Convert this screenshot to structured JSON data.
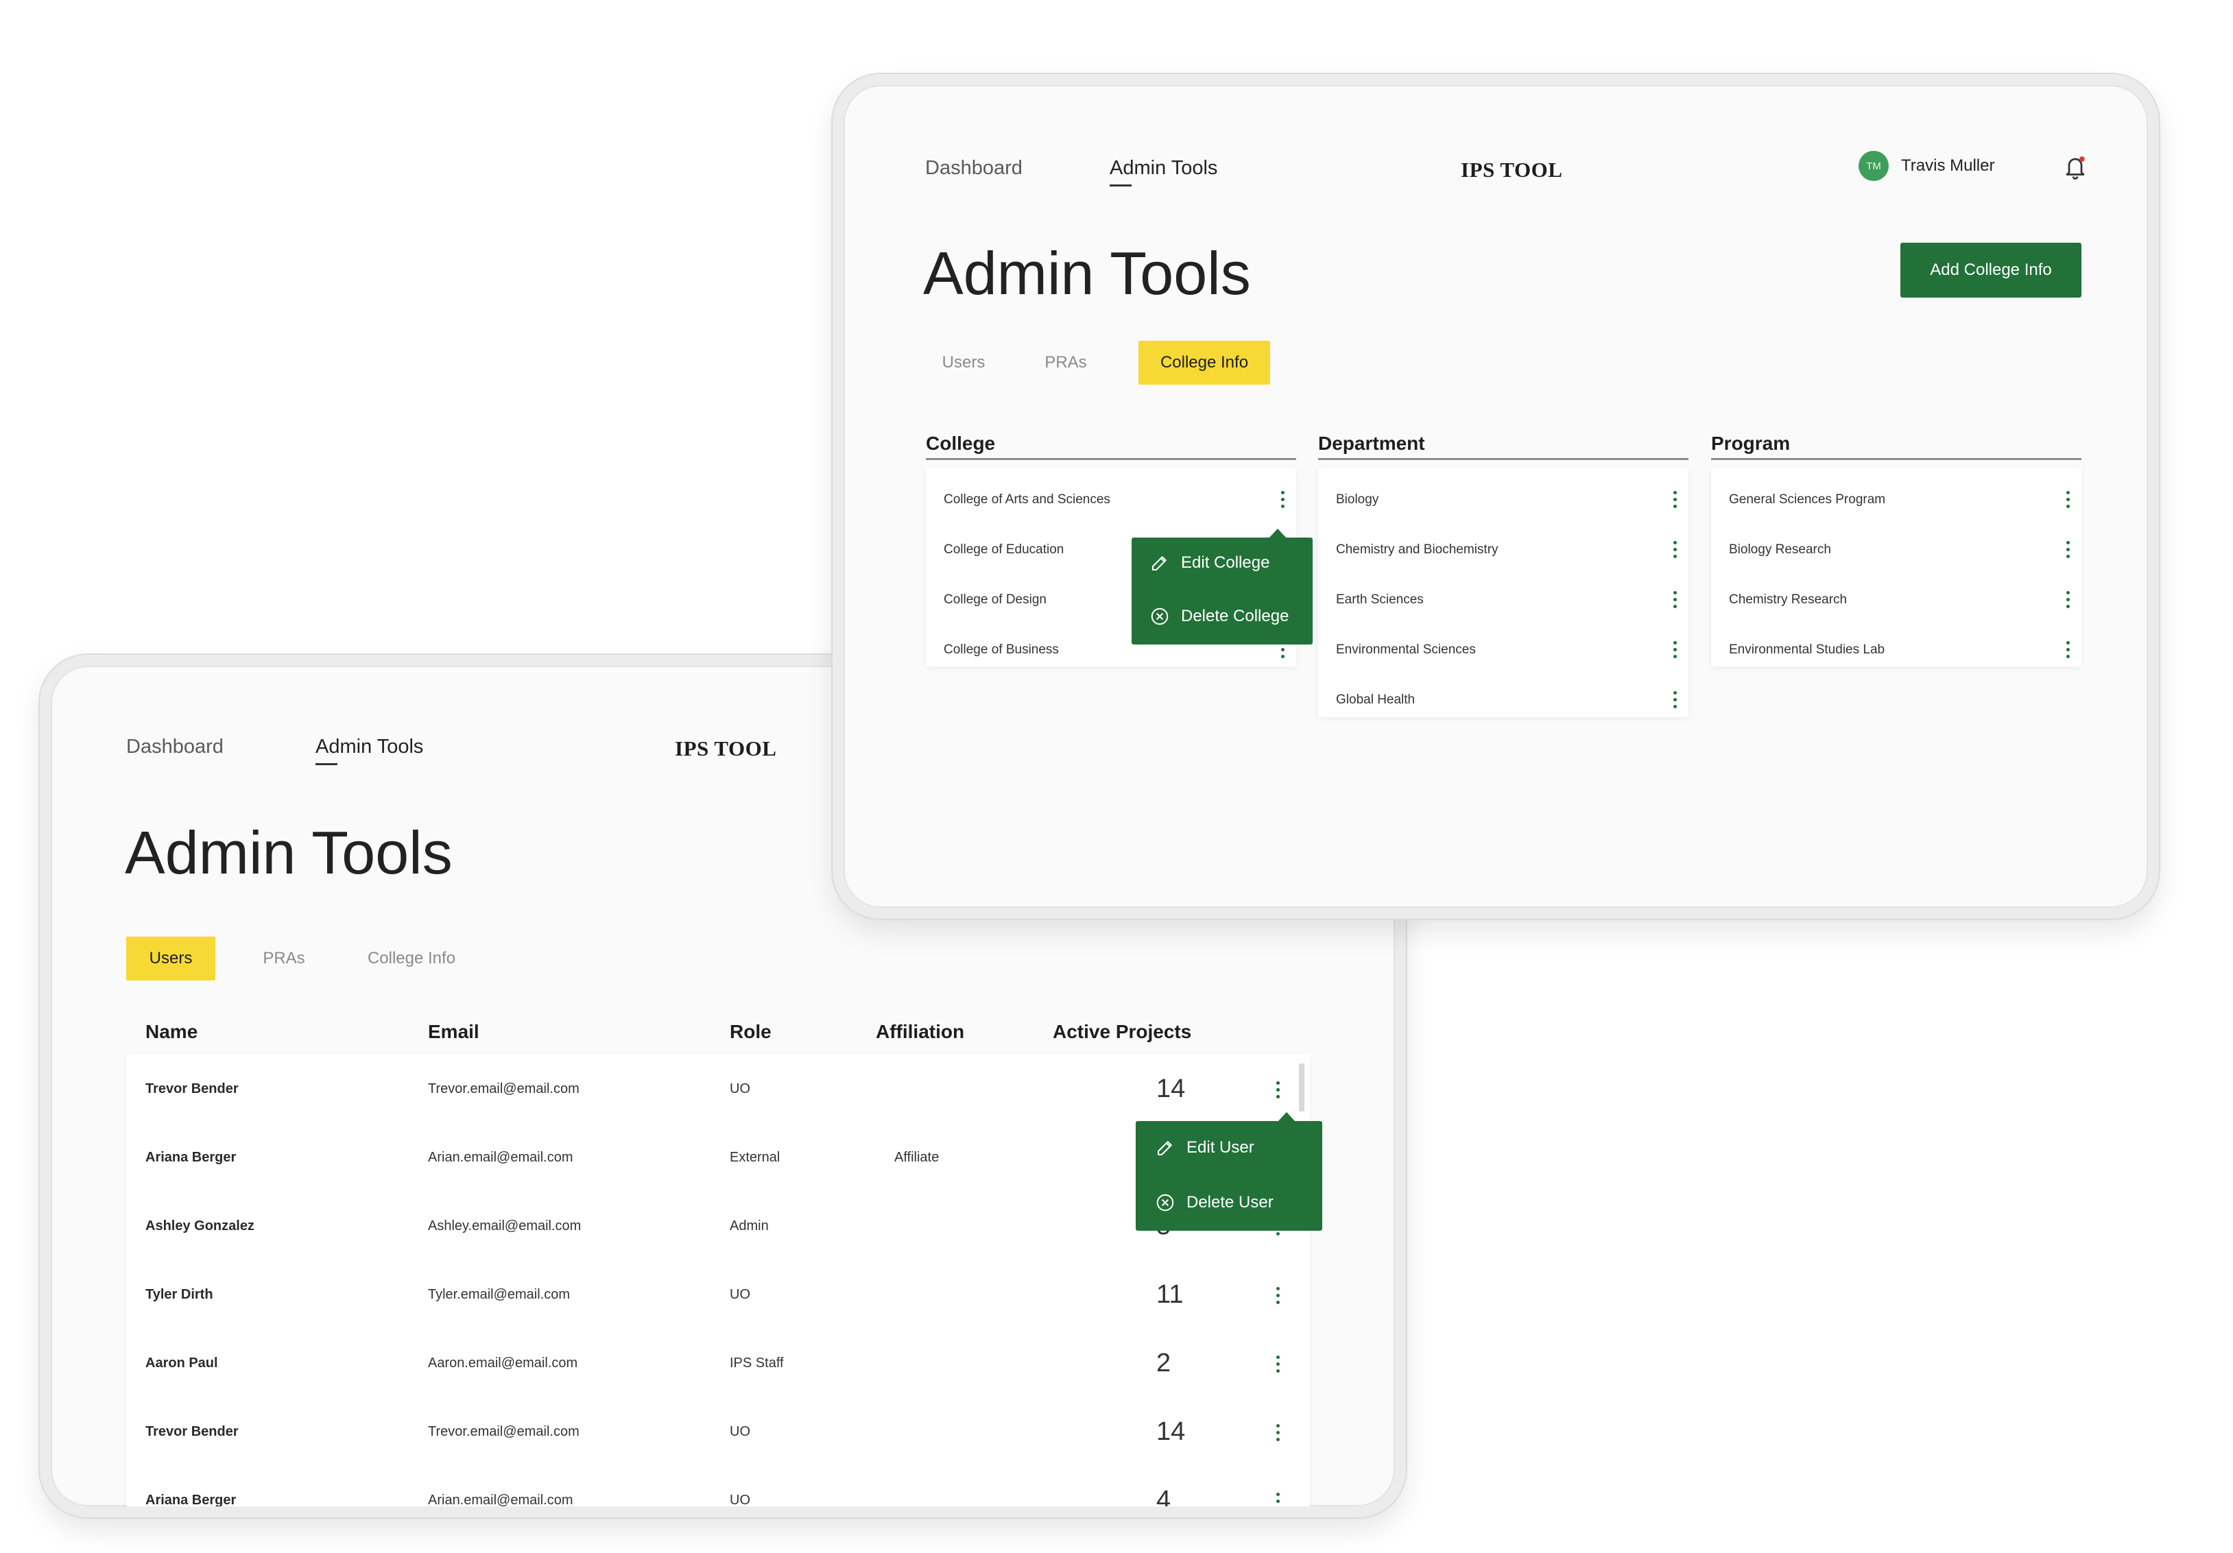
{
  "front": {
    "nav": {
      "dashboard": "Dashboard",
      "admin_tools": "Admin Tools",
      "brand": "IPS TOOL",
      "user_initials": "TM",
      "user_name": "Travis Muller"
    },
    "title": "Admin Tools",
    "primary_button": "Add College Info",
    "tabs": [
      "Users",
      "PRAs",
      "College Info"
    ],
    "active_tab": "College Info",
    "columns": {
      "college": {
        "header": "College",
        "items": [
          "College of Arts and Sciences",
          "College of Education",
          "College of Design",
          "College of Business"
        ]
      },
      "department": {
        "header": "Department",
        "items": [
          "Biology",
          "Chemistry and Biochemistry",
          "Earth Sciences",
          "Environmental Sciences",
          "Global Health"
        ]
      },
      "program": {
        "header": "Program",
        "items": [
          "General Sciences Program",
          "Biology Research",
          "Chemistry Research",
          "Environmental Studies Lab"
        ]
      }
    },
    "menu": {
      "edit": "Edit College",
      "delete": "Delete College"
    }
  },
  "back": {
    "nav": {
      "dashboard": "Dashboard",
      "admin_tools": "Admin Tools",
      "brand": "IPS TOOL"
    },
    "title": "Admin Tools",
    "tabs": [
      "Users",
      "PRAs",
      "College Info"
    ],
    "active_tab": "Users",
    "table": {
      "headers": [
        "Name",
        "Email",
        "Role",
        "Affiliation",
        "Active Projects"
      ],
      "rows": [
        {
          "name": "Trevor Bender",
          "email": "Trevor.email@email.com",
          "role": "UO",
          "affiliation": "",
          "projects": "14"
        },
        {
          "name": "Ariana Berger",
          "email": "Arian.email@email.com",
          "role": "External",
          "affiliation": "Affiliate",
          "projects": ""
        },
        {
          "name": "Ashley Gonzalez",
          "email": "Ashley.email@email.com",
          "role": "Admin",
          "affiliation": "",
          "projects": "5"
        },
        {
          "name": "Tyler Dirth",
          "email": "Tyler.email@email.com",
          "role": "UO",
          "affiliation": "",
          "projects": "11"
        },
        {
          "name": "Aaron Paul",
          "email": "Aaron.email@email.com",
          "role": "IPS Staff",
          "affiliation": "",
          "projects": "2"
        },
        {
          "name": "Trevor Bender",
          "email": "Trevor.email@email.com",
          "role": "UO",
          "affiliation": "",
          "projects": "14"
        },
        {
          "name": "Ariana Berger",
          "email": "Arian.email@email.com",
          "role": "UO",
          "affiliation": "",
          "projects": "4"
        }
      ]
    },
    "menu": {
      "edit": "Edit User",
      "delete": "Delete User"
    }
  },
  "colors": {
    "accent_green": "#227139",
    "tab_yellow": "#f7d936",
    "avatar_green": "#3f9e5a",
    "notification_dot": "#d23b3b"
  },
  "icons": [
    "pencil-icon",
    "circle-x-icon",
    "bell-icon",
    "kebab-icon"
  ]
}
